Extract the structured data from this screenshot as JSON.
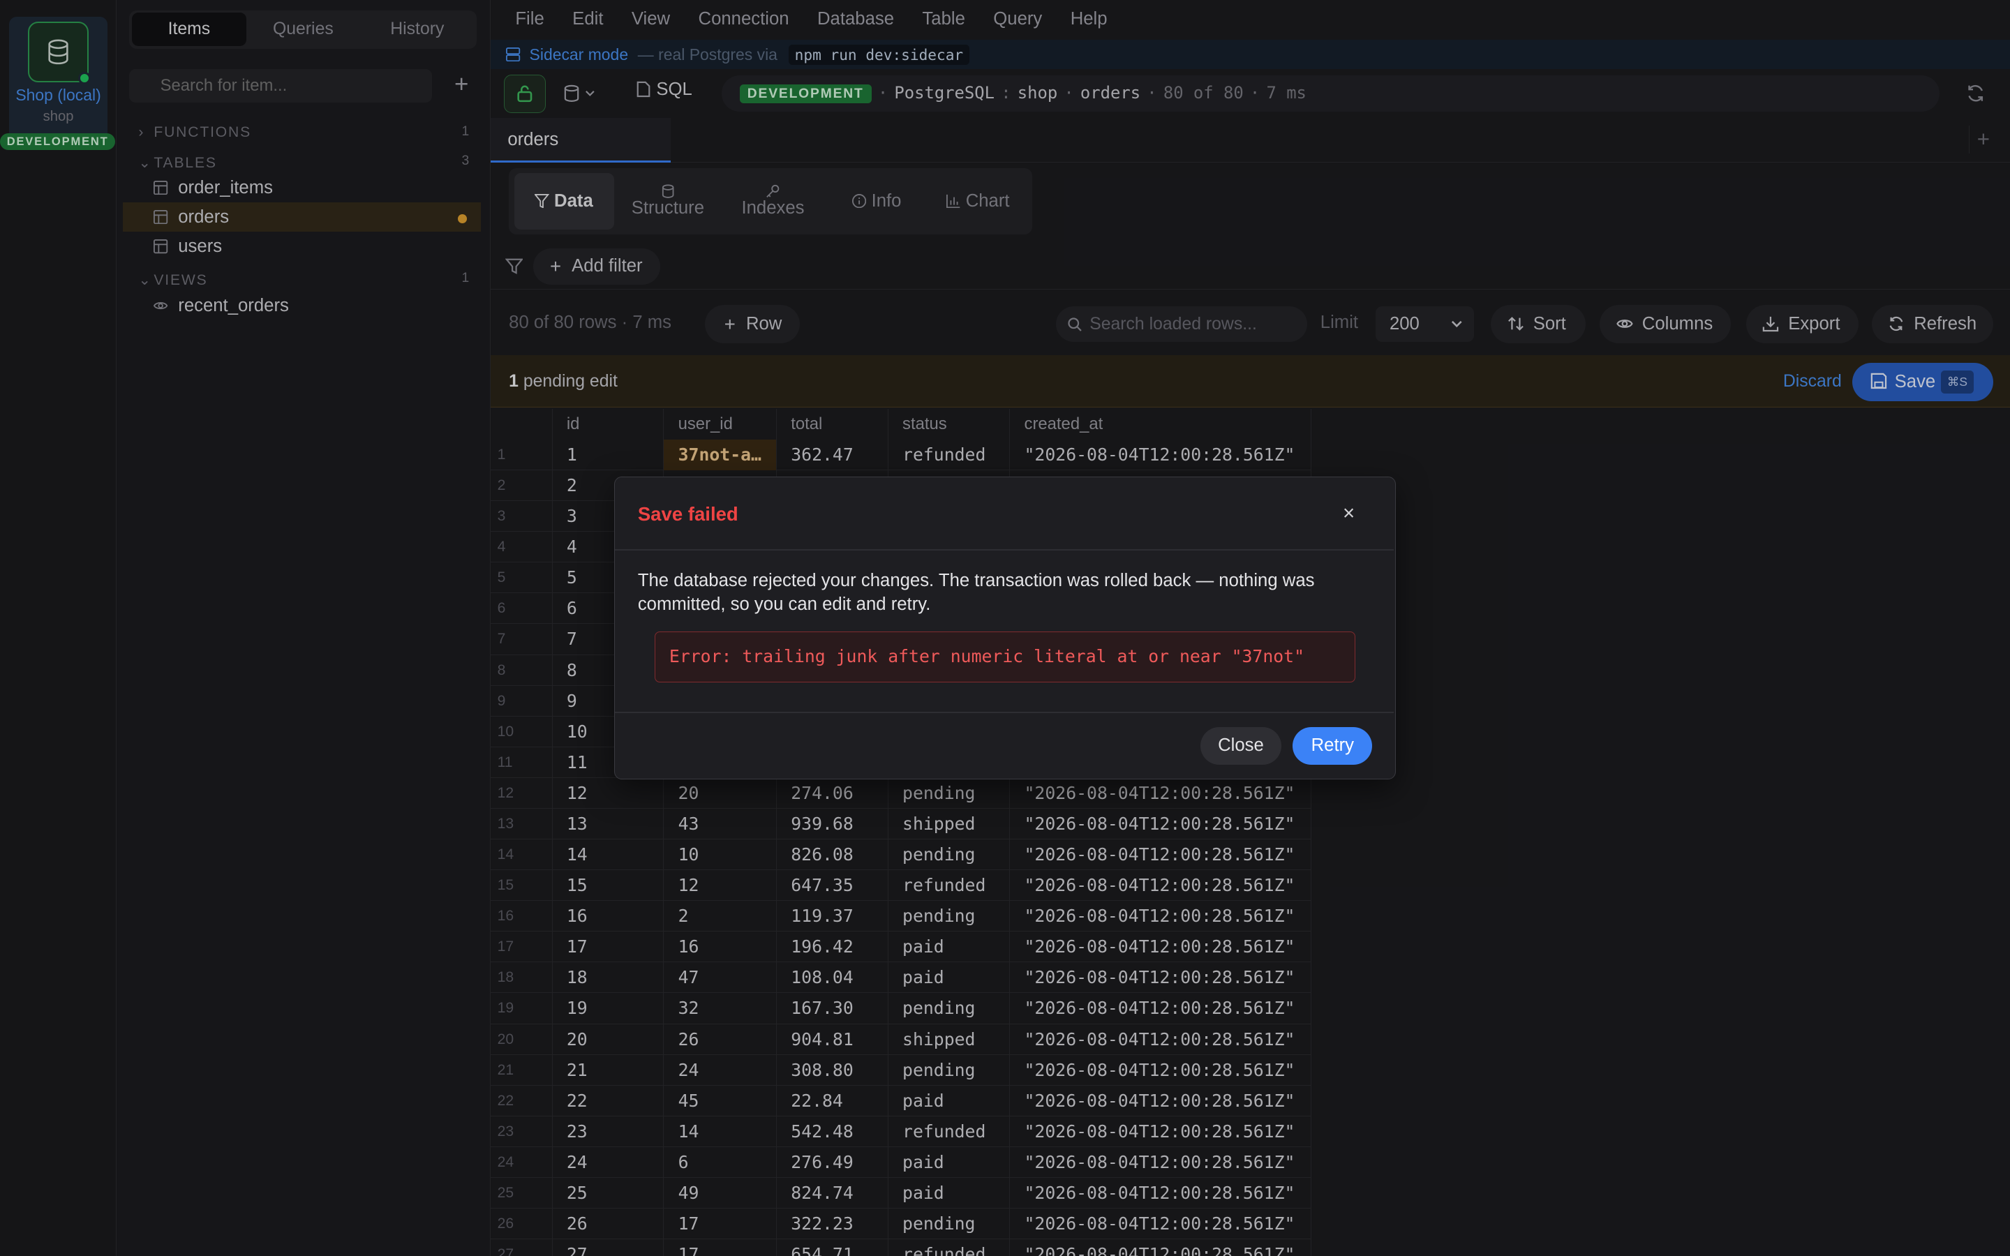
{
  "rail": {
    "connection_name": "Shop (local)",
    "connection_db": "shop",
    "env": "DEVELOPMENT"
  },
  "sidebar": {
    "tabs": [
      "Items",
      "Queries",
      "History"
    ],
    "search_placeholder": "Search for item...",
    "groups": {
      "functions": {
        "label": "FUNCTIONS",
        "count": "1"
      },
      "tables": {
        "label": "TABLES",
        "count": "3"
      },
      "views": {
        "label": "VIEWS",
        "count": "1"
      }
    },
    "tables": [
      "order_items",
      "orders",
      "users"
    ],
    "views": [
      "recent_orders"
    ]
  },
  "menu": [
    "File",
    "Edit",
    "View",
    "Connection",
    "Database",
    "Table",
    "Query",
    "Help"
  ],
  "sidecar": {
    "label": "Sidecar mode",
    "detail": "— real Postgres via",
    "command": "npm run dev:sidecar"
  },
  "toolbar": {
    "sql_label": "SQL",
    "env": "DEVELOPMENT",
    "engine": "PostgreSQL",
    "database": "shop",
    "table": "orders",
    "row_info": "80 of 80",
    "timing": "7 ms"
  },
  "tab": {
    "name": "orders"
  },
  "view_tabs": [
    "Data",
    "Structure",
    "Indexes",
    "Info",
    "Chart"
  ],
  "filter": {
    "add_label": "Add filter"
  },
  "rowbar": {
    "count": "80 of 80 rows",
    "timing": "· 7 ms",
    "add_row": "Row",
    "search_placeholder": "Search loaded rows...",
    "limit_label": "Limit",
    "limit_value": "200",
    "sort": "Sort",
    "columns": "Columns",
    "export": "Export",
    "refresh": "Refresh"
  },
  "pending": {
    "count": "1",
    "text": "pending edit",
    "discard": "Discard",
    "save": "Save",
    "save_kbd": "⌘S"
  },
  "grid": {
    "columns": [
      "id",
      "user_id",
      "total",
      "status",
      "created_at"
    ],
    "rows": [
      [
        "1",
        "1",
        "37not-a…",
        "362.47",
        "refunded",
        "\"2026-08-04T12:00:28.561Z\""
      ],
      [
        "2",
        "2",
        "",
        "",
        "",
        ""
      ],
      [
        "3",
        "3",
        "",
        "",
        "",
        ""
      ],
      [
        "4",
        "4",
        "",
        "",
        "",
        ""
      ],
      [
        "5",
        "5",
        "",
        "",
        "",
        ""
      ],
      [
        "6",
        "6",
        "",
        "",
        "",
        ""
      ],
      [
        "7",
        "7",
        "",
        "",
        "",
        ""
      ],
      [
        "8",
        "8",
        "",
        "",
        "",
        ""
      ],
      [
        "9",
        "9",
        "",
        "",
        "",
        ""
      ],
      [
        "10",
        "10",
        "",
        "",
        "",
        ""
      ],
      [
        "11",
        "11",
        "",
        "",
        "",
        ""
      ],
      [
        "12",
        "12",
        "20",
        "274.06",
        "pending",
        "\"2026-08-04T12:00:28.561Z\""
      ],
      [
        "13",
        "13",
        "43",
        "939.68",
        "shipped",
        "\"2026-08-04T12:00:28.561Z\""
      ],
      [
        "14",
        "14",
        "10",
        "826.08",
        "pending",
        "\"2026-08-04T12:00:28.561Z\""
      ],
      [
        "15",
        "15",
        "12",
        "647.35",
        "refunded",
        "\"2026-08-04T12:00:28.561Z\""
      ],
      [
        "16",
        "16",
        "2",
        "119.37",
        "pending",
        "\"2026-08-04T12:00:28.561Z\""
      ],
      [
        "17",
        "17",
        "16",
        "196.42",
        "paid",
        "\"2026-08-04T12:00:28.561Z\""
      ],
      [
        "18",
        "18",
        "47",
        "108.04",
        "paid",
        "\"2026-08-04T12:00:28.561Z\""
      ],
      [
        "19",
        "19",
        "32",
        "167.30",
        "pending",
        "\"2026-08-04T12:00:28.561Z\""
      ],
      [
        "20",
        "20",
        "26",
        "904.81",
        "shipped",
        "\"2026-08-04T12:00:28.561Z\""
      ],
      [
        "21",
        "21",
        "24",
        "308.80",
        "pending",
        "\"2026-08-04T12:00:28.561Z\""
      ],
      [
        "22",
        "22",
        "45",
        "22.84",
        "paid",
        "\"2026-08-04T12:00:28.561Z\""
      ],
      [
        "23",
        "23",
        "14",
        "542.48",
        "refunded",
        "\"2026-08-04T12:00:28.561Z\""
      ],
      [
        "24",
        "24",
        "6",
        "276.49",
        "paid",
        "\"2026-08-04T12:00:28.561Z\""
      ],
      [
        "25",
        "25",
        "49",
        "824.74",
        "paid",
        "\"2026-08-04T12:00:28.561Z\""
      ],
      [
        "26",
        "26",
        "17",
        "322.23",
        "pending",
        "\"2026-08-04T12:00:28.561Z\""
      ],
      [
        "27",
        "27",
        "17",
        "654.71",
        "refunded",
        "\"2026-08-04T12:00:28.561Z\""
      ]
    ]
  },
  "modal": {
    "title": "Save failed",
    "close_x": "×",
    "message": "The database rejected your changes. The transaction was rolled back — nothing was committed, so you can edit and retry.",
    "error": "Error: trailing junk after numeric literal at or near \"37not\"",
    "close_button": "Close",
    "retry_button": "Retry"
  },
  "colors": {
    "accent": "#3b82f6",
    "error": "#ef4444",
    "env_green": "#1f7a3a",
    "pending_bg": "#2a2418"
  }
}
